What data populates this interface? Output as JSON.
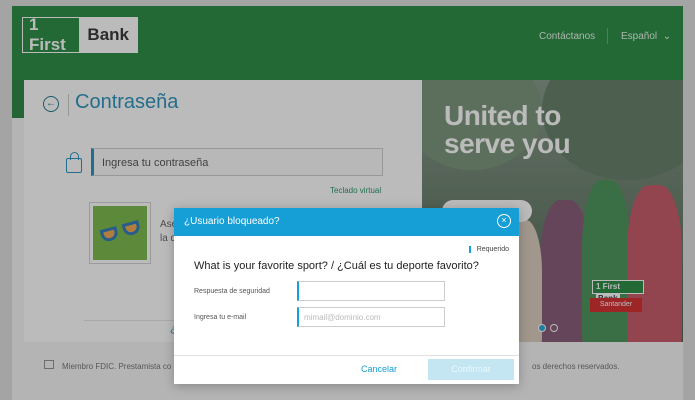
{
  "header": {
    "logo_first": "1 First",
    "logo_bank": "Bank",
    "contact_link": "Contáctanos",
    "language": "Español"
  },
  "page": {
    "title": "Contraseña",
    "password_placeholder": "Ingresa tu contraseña",
    "virtual_keyboard": "Teclado virtual",
    "security_image_text": "Asegú\nla que",
    "forgot_link": "¿O"
  },
  "banner": {
    "headline": "United to\nserve you",
    "logo_first": "1 First",
    "logo_bank": "Bank",
    "santander": "Santander"
  },
  "footer": {
    "left": "Miembro FDIC. Prestamista co",
    "right": "os derechos reservados."
  },
  "modal": {
    "title": "¿Usuario bloqueado?",
    "required_label": "Requerido",
    "question": "What is your favorite sport? / ¿Cuál es tu deporte favorito?",
    "answer_label": "Respuesta de seguridad",
    "answer_value": "",
    "email_label": "Ingresa tu e-mail",
    "email_placeholder": "mimail@dominio.com",
    "cancel_label": "Cancelar",
    "confirm_label": "Confirmar"
  },
  "colors": {
    "header_green": "#148232",
    "accent_blue": "#159fd6",
    "santander_red": "#d21a1a"
  }
}
